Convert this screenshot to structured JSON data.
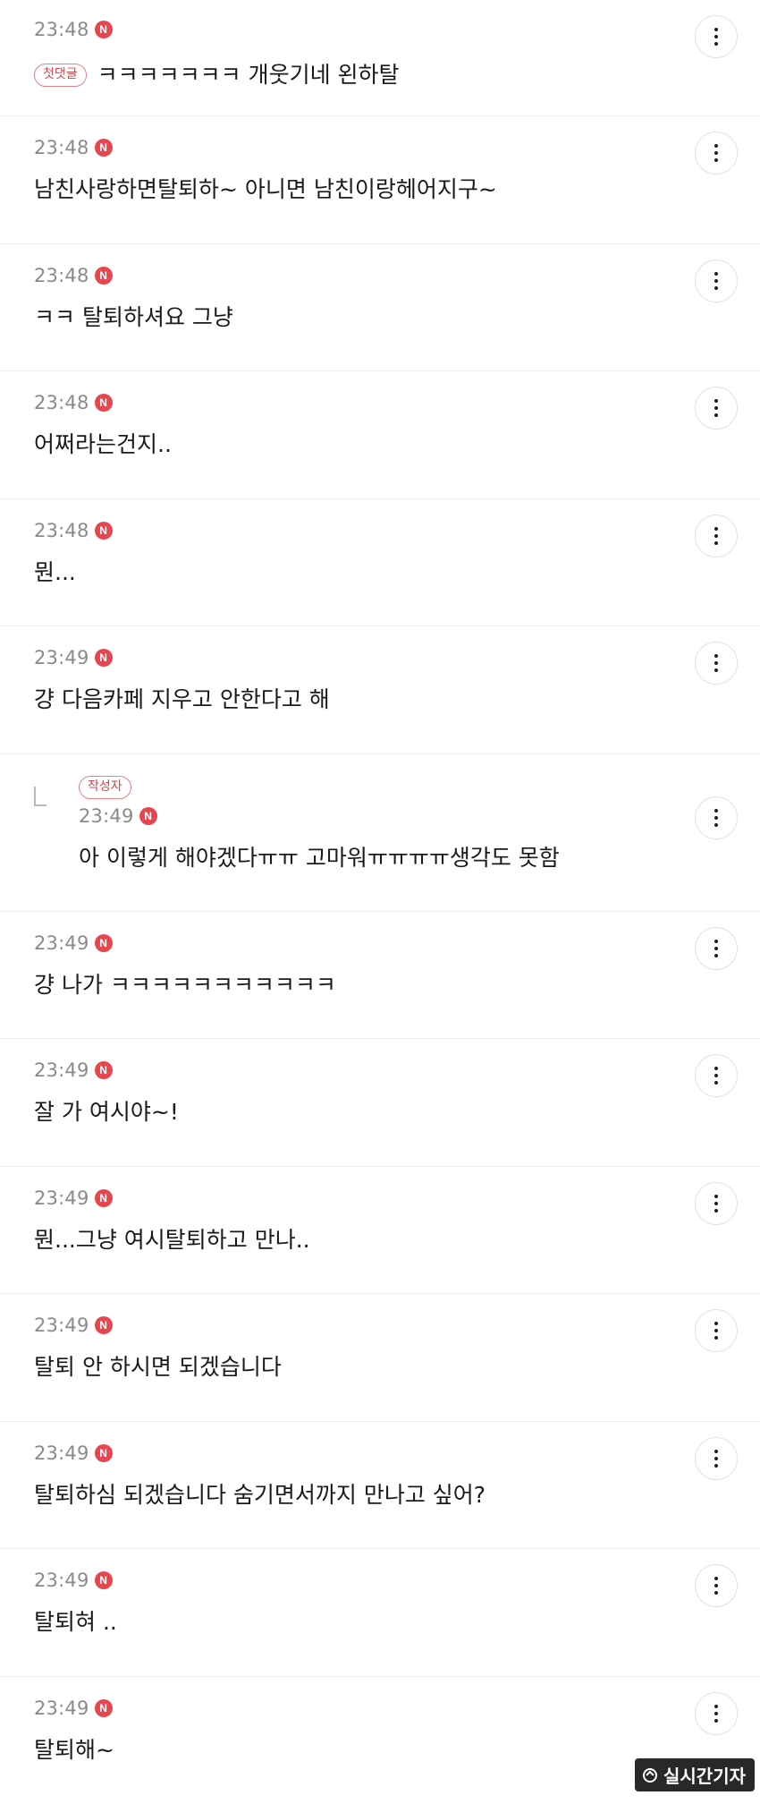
{
  "badges": {
    "new": "N",
    "first": "첫댓글",
    "author": "작성자"
  },
  "comments": [
    {
      "time": "23:48",
      "text": "ㅋㅋㅋㅋㅋㅋㅋ 개웃기네 왼하탈"
    },
    {
      "time": "23:48",
      "text": "남친사랑하면탈퇴하~ 아니면 남친이랑헤어지구~"
    },
    {
      "time": "23:48",
      "text": "ㅋㅋ 탈퇴하셔요 그냥"
    },
    {
      "time": "23:48",
      "text": "어쩌라는건지.."
    },
    {
      "time": "23:48",
      "text": "뭔..."
    },
    {
      "time": "23:49",
      "text": "걍 다음카페 지우고 안한다고 해"
    },
    {
      "time": "23:49",
      "text": "아 이렇게 해야겠다ㅠㅠ 고마워ㅠㅠㅠㅠ생각도 못함"
    },
    {
      "time": "23:49",
      "text": "걍 나가 ㅋㅋㅋㅋㅋㅋㅋㅋㅋㅋㅋ"
    },
    {
      "time": "23:49",
      "text": "잘 가 여시야~!"
    },
    {
      "time": "23:49",
      "text": "뭔...그냥 여시탈퇴하고 만나.."
    },
    {
      "time": "23:49",
      "text": "탈퇴 안 하시면 되겠습니다"
    },
    {
      "time": "23:49",
      "text": "탈퇴하심 되겠습니다 숨기면서까지 만나고 싶어?"
    },
    {
      "time": "23:49",
      "text": "탈퇴혀 .."
    },
    {
      "time": "23:49",
      "text": "탈퇴해~"
    }
  ],
  "watermark": {
    "label": "실시간기자"
  },
  "colors": {
    "accent": "#e8464f",
    "badge_border": "#e2838a",
    "timestamp": "#8a8a8a",
    "divider": "#ececec"
  },
  "icons": {
    "more": "vertical-ellipsis-icon",
    "new": "new-badge-icon",
    "reply": "reply-arrow-icon"
  }
}
